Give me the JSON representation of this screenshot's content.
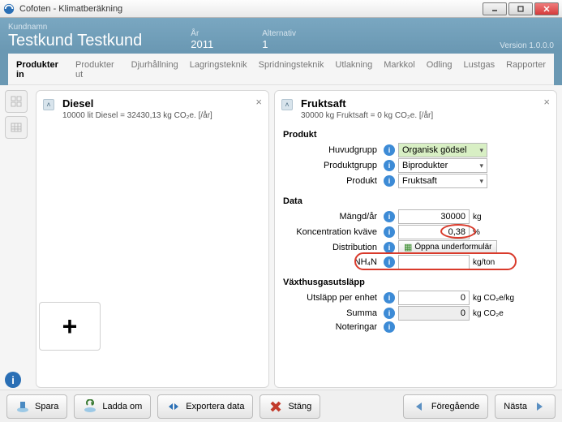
{
  "window": {
    "title": "Cofoten - Klimatberäkning",
    "version": "Version 1.0.0.0"
  },
  "header": {
    "customer_label": "Kundnamn",
    "customer": "Testkund Testkund",
    "year_label": "År",
    "year": "2011",
    "alt_label": "Alternativ",
    "alt": "1"
  },
  "tabs": [
    "Produkter in",
    "Produkter ut",
    "Djurhållning",
    "Lagringsteknik",
    "Spridningsteknik",
    "Utlakning",
    "Markkol",
    "Odling",
    "Lustgas",
    "Rapporter"
  ],
  "active_tab": "Produkter in",
  "left_card": {
    "title": "Diesel",
    "sub": "10000 lit Diesel = 32430,13 kg CO₂e. [/år]"
  },
  "right_card": {
    "title": "Fruktsaft",
    "sub": "30000 kg Fruktsaft = 0 kg CO₂e. [/år]",
    "sections": {
      "produkt": "Produkt",
      "data": "Data",
      "vaxthus": "Växthusgasutsläpp"
    },
    "rows": {
      "huvudgrupp_l": "Huvudgrupp",
      "huvudgrupp_v": "Organisk gödsel",
      "produktgrupp_l": "Produktgrupp",
      "produktgrupp_v": "Biprodukter",
      "produkt_l": "Produkt",
      "produkt_v": "Fruktsaft",
      "mangd_l": "Mängd/år",
      "mangd_v": "30000",
      "mangd_u": "kg",
      "kvave_l": "Koncentration kväve",
      "kvave_v": "0,38",
      "kvave_u": "%",
      "dist_l": "Distribution",
      "dist_btn": "Öppna underformulär",
      "nh4n_l": "NH₄N",
      "nh4n_v": "",
      "nh4n_u": "kg/ton",
      "utslapp_l": "Utsläpp per enhet",
      "utslapp_v": "0",
      "utslapp_u": "kg CO₂e/kg",
      "summa_l": "Summa",
      "summa_v": "0",
      "summa_u": "kg CO₂e",
      "noter_l": "Noteringar"
    }
  },
  "footer": {
    "spara": "Spara",
    "ladda": "Ladda om",
    "export": "Exportera data",
    "stang": "Stäng",
    "prev": "Föregående",
    "next": "Nästa"
  }
}
